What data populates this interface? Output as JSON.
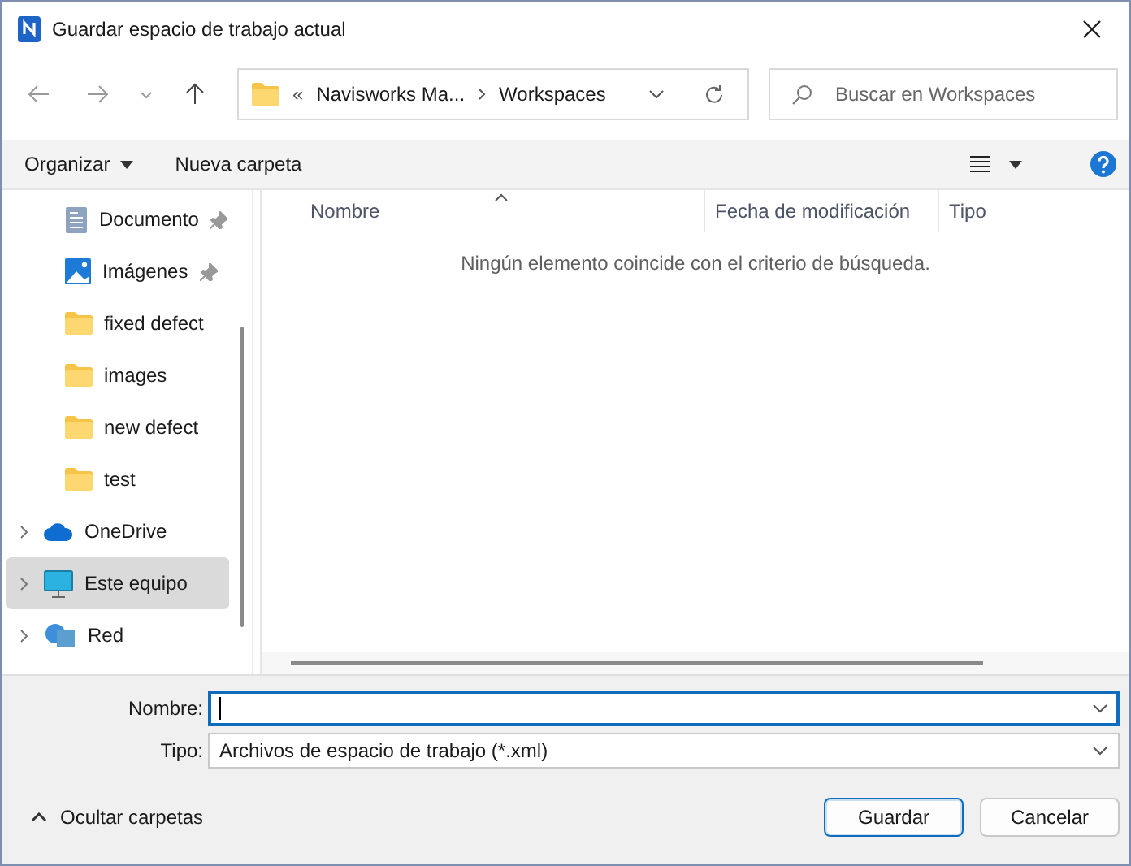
{
  "window": {
    "title": "Guardar espacio de trabajo actual"
  },
  "address": {
    "overflow": "«",
    "segments": [
      "Navisworks Ma...",
      "Workspaces"
    ]
  },
  "search": {
    "placeholder": "Buscar en Workspaces"
  },
  "toolbar": {
    "organize": "Organizar",
    "new_folder": "Nueva carpeta"
  },
  "nav": [
    {
      "label": "Documento",
      "kind": "document",
      "pinned": true,
      "expandable": false,
      "selected": false
    },
    {
      "label": "Imágenes",
      "kind": "picture",
      "pinned": true,
      "expandable": false,
      "selected": false
    },
    {
      "label": "fixed defect",
      "kind": "folder",
      "pinned": false,
      "expandable": false,
      "selected": false
    },
    {
      "label": "images",
      "kind": "folder",
      "pinned": false,
      "expandable": false,
      "selected": false
    },
    {
      "label": "new defect",
      "kind": "folder",
      "pinned": false,
      "expandable": false,
      "selected": false
    },
    {
      "label": "test",
      "kind": "folder",
      "pinned": false,
      "expandable": false,
      "selected": false
    },
    {
      "label": "OneDrive",
      "kind": "cloud",
      "pinned": false,
      "expandable": true,
      "selected": false
    },
    {
      "label": "Este equipo",
      "kind": "computer",
      "pinned": false,
      "expandable": true,
      "selected": true
    },
    {
      "label": "Red",
      "kind": "network",
      "pinned": false,
      "expandable": true,
      "selected": false
    }
  ],
  "table": {
    "columns": [
      "Nombre",
      "Fecha de modificación",
      "Tipo"
    ],
    "empty_message": "Ningún elemento coincide con el criterio de búsqueda."
  },
  "form": {
    "name_label": "Nombre:",
    "type_label": "Tipo:",
    "type_value": "Archivos de espacio de trabajo (*.xml)"
  },
  "hide_folders": "Ocultar carpetas",
  "buttons": [
    {
      "label": "Guardar",
      "default": true
    },
    {
      "label": "Cancelar",
      "default": false
    }
  ]
}
